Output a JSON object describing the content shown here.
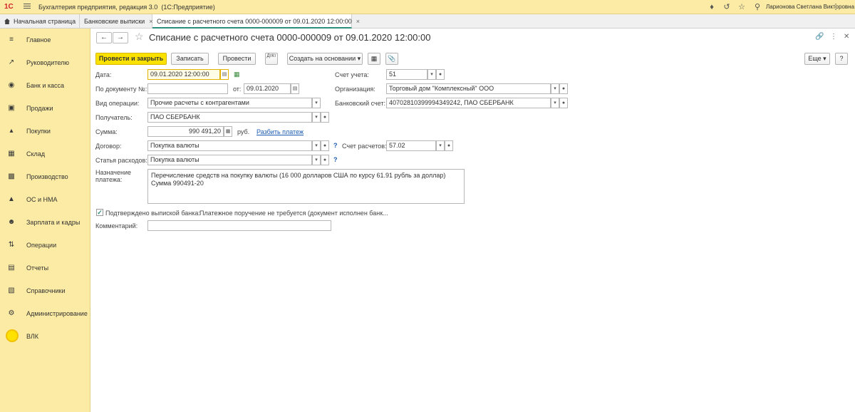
{
  "app": {
    "logo": "1С",
    "title": "Бухгалтерия предприятия, редакция 3.0",
    "platform": "(1С:Предприятие)",
    "user": "Ларионова Светлана Викторовна"
  },
  "tabs": [
    {
      "label": "Начальная страница"
    },
    {
      "label": "Банковские выписки",
      "close": "×"
    },
    {
      "label": "Списание с расчетного счета 0000-000009 от 09.01.2020 12:00:00",
      "close": "×"
    }
  ],
  "sidebar": {
    "items": [
      {
        "label": "Главное",
        "icon": "menu-icon"
      },
      {
        "label": "Руководителю",
        "icon": "chart-trend-icon"
      },
      {
        "label": "Банк и касса",
        "icon": "coin-icon"
      },
      {
        "label": "Продажи",
        "icon": "bag-icon"
      },
      {
        "label": "Покупки",
        "icon": "cart-icon"
      },
      {
        "label": "Склад",
        "icon": "warehouse-icon"
      },
      {
        "label": "Производство",
        "icon": "factory-icon"
      },
      {
        "label": "ОС и НМА",
        "icon": "truck-icon"
      },
      {
        "label": "Зарплата и кадры",
        "icon": "person-icon"
      },
      {
        "label": "Операции",
        "icon": "operations-icon"
      },
      {
        "label": "Отчеты",
        "icon": "report-icon"
      },
      {
        "label": "Справочники",
        "icon": "books-icon"
      },
      {
        "label": "Администрирование",
        "icon": "gear-icon"
      },
      {
        "label": "ВЛК",
        "icon": "vlk-circle-icon"
      }
    ]
  },
  "document": {
    "title": "Списание с расчетного счета 0000-000009 от 09.01.2020 12:00:00",
    "nav_back": "←",
    "nav_forward": "→",
    "toolbar": {
      "post_close": "Провести и закрыть",
      "save": "Записать",
      "post": "Провести",
      "create_based": "Создать на основании",
      "dt_kt": "ДтКт",
      "more": "Еще"
    },
    "labels": {
      "date": "Дата:",
      "doc_number": "По документу №:",
      "from": "от:",
      "operation_type": "Вид операции:",
      "recipient": "Получатель:",
      "amount": "Сумма:",
      "contract": "Договор:",
      "expense_item": "Статья расходов:",
      "purpose": "Назначение платежа:",
      "account": "Счет учета:",
      "organization": "Организация:",
      "bank_account": "Банковский счет:",
      "settlement_account": "Счет расчетов:",
      "confirmed": "Подтверждено выпиской банка:",
      "comment": "Комментарий:"
    },
    "values": {
      "date": "09.01.2020 12:00:00",
      "doc_number": "",
      "from_date": "09.01.2020",
      "operation_type": "Прочие расчеты с контрагентами",
      "recipient": "ПАО СБЕРБАНК",
      "amount": "990 491,20",
      "currency": "руб.",
      "split_payment": "Разбить платеж",
      "contract": "Покупка валюты",
      "expense_item": "Покупка валюты",
      "purpose_line1": "Перечисление средств на покупку валюты (16 000 долларов США по курсу 61.91 рубль за доллар)",
      "purpose_line2": "Сумма 990491-20",
      "account": "51",
      "organization": "Торговый дом \"Комплексный\" ООО",
      "bank_account": "40702810399994349242, ПАО СБЕРБАНК",
      "settlement_account": "57.02",
      "confirmed_note": "Платежное поручение не требуется (документ исполнен банк...",
      "comment": "",
      "help": "?"
    }
  },
  "colors": {
    "sidebar_bg": "#fbeba4",
    "primary_button": "#fbe100",
    "link": "#1a5bb4",
    "active_tab_underline": "#2b8f7c"
  }
}
